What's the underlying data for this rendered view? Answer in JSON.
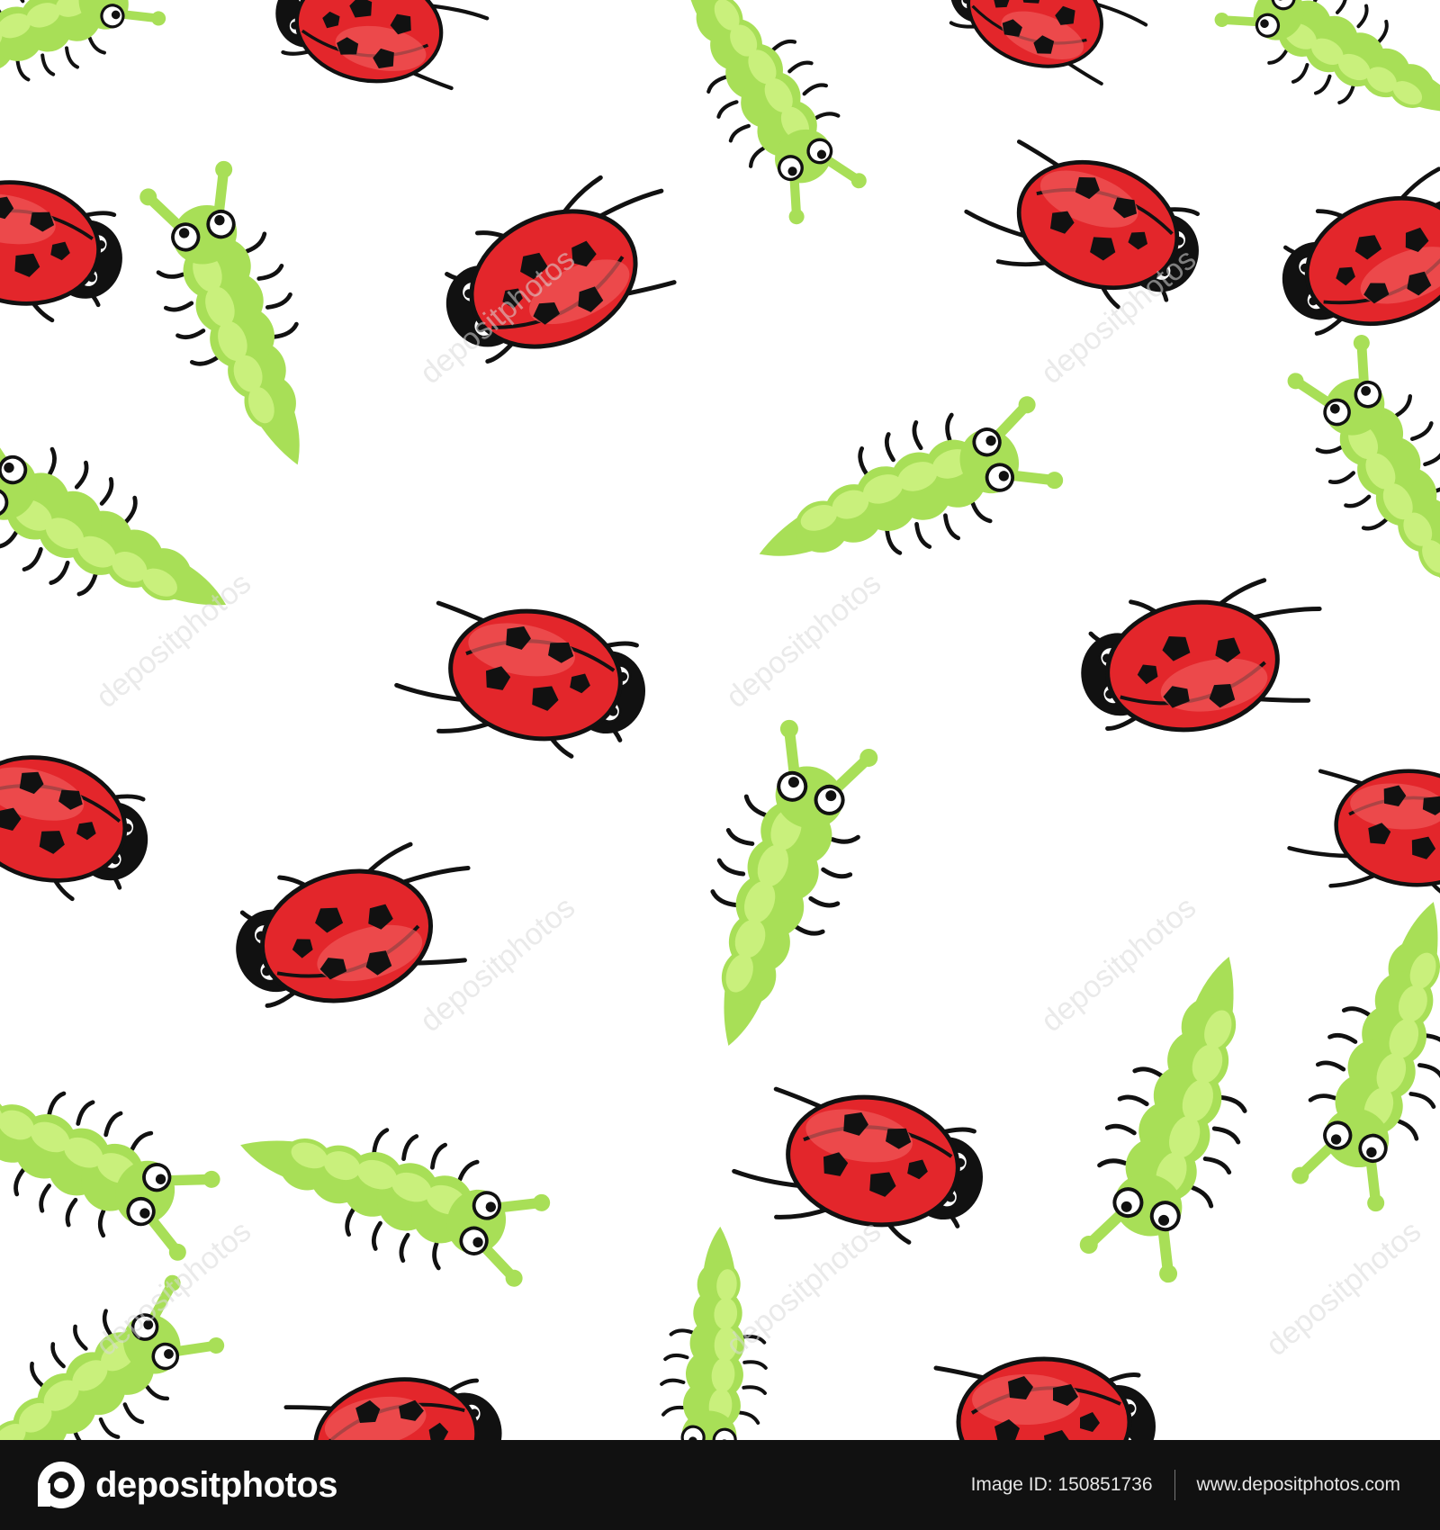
{
  "image": {
    "description_colors": {
      "background": "#ffffff",
      "ladybug_shell": "#e3262b",
      "ladybug_highlight": "#f0595a",
      "caterpillar_body": "#a8df57",
      "caterpillar_highlight": "#c9f07c",
      "outline": "#111111"
    },
    "subjects": [
      "ladybug",
      "caterpillar"
    ]
  },
  "watermark": {
    "text": "depositphotos"
  },
  "footer": {
    "brand": "depositphotos",
    "image_id_label": "Image ID: 150851736",
    "website": "www.depositphotos.com",
    "logo_icon": "depositphotos-logo-icon"
  }
}
